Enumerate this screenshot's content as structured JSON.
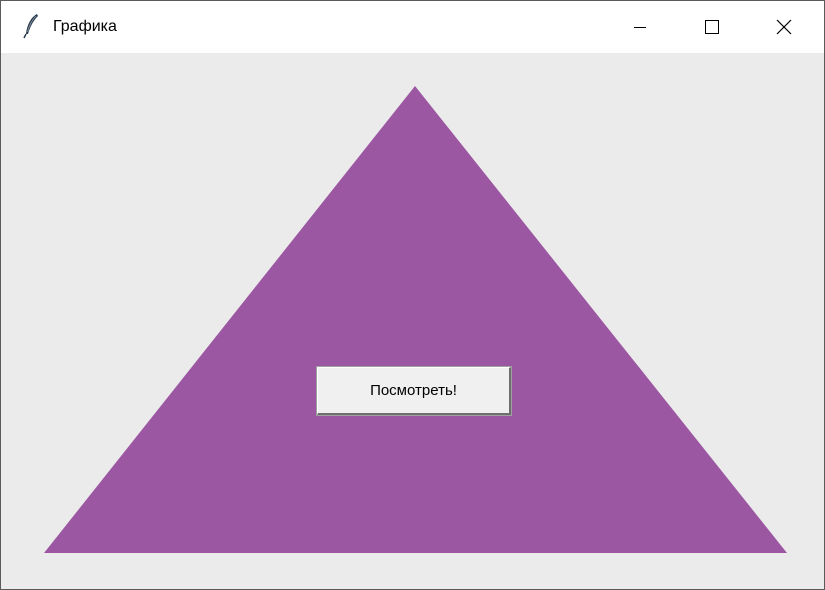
{
  "window": {
    "title": "Графика",
    "icon": "feather-icon"
  },
  "titlebar_controls": {
    "minimize_icon": "minimize-icon",
    "maximize_icon": "maximize-icon",
    "close_icon": "close-icon"
  },
  "canvas": {
    "background_color": "#ebebeb",
    "shape": "triangle",
    "shape_fill": "#9c57a2"
  },
  "button": {
    "label": "Посмотреть!"
  }
}
